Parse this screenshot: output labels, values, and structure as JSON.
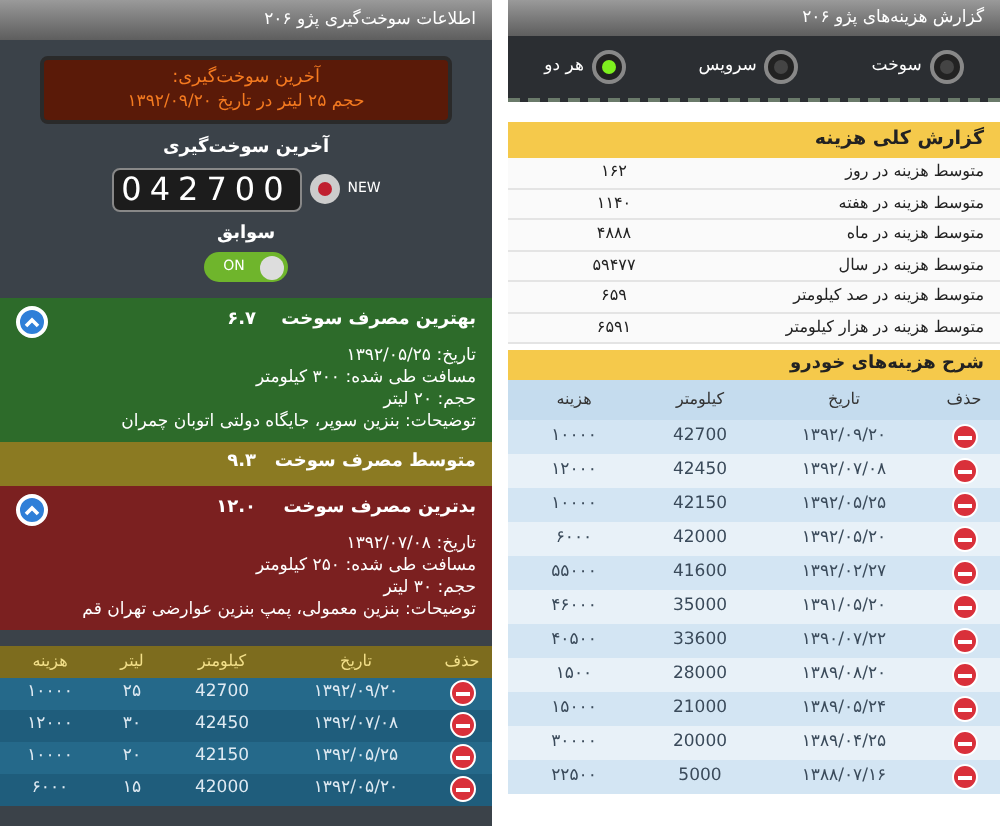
{
  "fuel_screen": {
    "title": "اطلاعات سوخت‌گیری پژو ۲۰۶",
    "last_fill_banner": {
      "heading": "آخرین سوخت‌گیری:",
      "detail": "حجم ۲۵ لیتر در تاریخ ۱۳۹۲/۰۹/۲۰"
    },
    "odometer": {
      "label": "آخرین سوخت‌گیری",
      "value": "042700",
      "new_label": "NEW"
    },
    "history_toggle": {
      "label": "سوابق",
      "text": "ON",
      "on": true
    },
    "best": {
      "title": "بهترین مصرف سوخت",
      "value": "۶.۷",
      "expanded": true,
      "details": [
        "تاریخ: ۱۳۹۲/۰۵/۲۵",
        "مسافت طی شده: ۳۰۰ کیلومتر",
        "حجم: ۲۰ لیتر",
        "توضیحات: بنزین سوپر، جایگاه دولتی اتوبان چمران"
      ]
    },
    "average": {
      "title": "متوسط مصرف سوخت",
      "value": "۹.۳"
    },
    "worst": {
      "title": "بدترین مصرف سوخت",
      "value": "۱۲.۰",
      "expanded": true,
      "details": [
        "تاریخ: ۱۳۹۲/۰۷/۰۸",
        "مسافت طی شده: ۲۵۰ کیلومتر",
        "حجم: ۳۰ لیتر",
        "توضیحات: بنزین معمولی، پمپ بنزین عوارضی تهران قم"
      ]
    },
    "table": {
      "delete_column": "حذف",
      "columns": [
        "تاریخ",
        "کیلومتر",
        "لیتر",
        "هزینه"
      ],
      "rows": [
        [
          "۱۳۹۲/۰۹/۲۰",
          "42700",
          "۲۵",
          "۱۰۰۰۰"
        ],
        [
          "۱۳۹۲/۰۷/۰۸",
          "42450",
          "۳۰",
          "۱۲۰۰۰"
        ],
        [
          "۱۳۹۲/۰۵/۲۵",
          "42150",
          "۲۰",
          "۱۰۰۰۰"
        ],
        [
          "۱۳۹۲/۰۵/۲۰",
          "42000",
          "۱۵",
          "۶۰۰۰"
        ]
      ]
    }
  },
  "cost_screen": {
    "title": "گزارش هزینه‌های پژو ۲۰۶",
    "filters": [
      {
        "label": "سوخت",
        "selected": false
      },
      {
        "label": "سرویس",
        "selected": false
      },
      {
        "label": "هر دو",
        "selected": true
      }
    ],
    "summary": {
      "title": "گزارش کلی هزینه",
      "rows": [
        {
          "label": "متوسط هزینه در روز",
          "value": "۱۶۲"
        },
        {
          "label": "متوسط هزینه در هفته",
          "value": "۱۱۴۰"
        },
        {
          "label": "متوسط هزینه در ماه",
          "value": "۴۸۸۸"
        },
        {
          "label": "متوسط هزینه در سال",
          "value": "۵۹۴۷۷"
        },
        {
          "label": "متوسط هزینه در صد کیلومتر",
          "value": "۶۵۹"
        },
        {
          "label": "متوسط هزینه در هزار کیلومتر",
          "value": "۶۵۹۱"
        }
      ]
    },
    "expenses": {
      "title": "شرح هزینه‌های خودرو",
      "delete_column": "حذف",
      "columns": [
        "تاریخ",
        "کیلومتر",
        "هزینه"
      ],
      "rows": [
        [
          "۱۳۹۲/۰۹/۲۰",
          "42700",
          "۱۰۰۰۰"
        ],
        [
          "۱۳۹۲/۰۷/۰۸",
          "42450",
          "۱۲۰۰۰"
        ],
        [
          "۱۳۹۲/۰۵/۲۵",
          "42150",
          "۱۰۰۰۰"
        ],
        [
          "۱۳۹۲/۰۵/۲۰",
          "42000",
          "۶۰۰۰"
        ],
        [
          "۱۳۹۲/۰۲/۲۷",
          "41600",
          "۵۵۰۰۰"
        ],
        [
          "۱۳۹۱/۰۵/۲۰",
          "35000",
          "۴۶۰۰۰"
        ],
        [
          "۱۳۹۰/۰۷/۲۲",
          "33600",
          "۴۰۵۰۰"
        ],
        [
          "۱۳۸۹/۰۸/۲۰",
          "28000",
          "۱۵۰۰"
        ],
        [
          "۱۳۸۹/۰۵/۲۴",
          "21000",
          "۱۵۰۰۰"
        ],
        [
          "۱۳۸۹/۰۴/۲۵",
          "20000",
          "۳۰۰۰۰"
        ],
        [
          "۱۳۸۸/۰۷/۱۶",
          "5000",
          "۲۲۵۰۰"
        ]
      ]
    }
  }
}
